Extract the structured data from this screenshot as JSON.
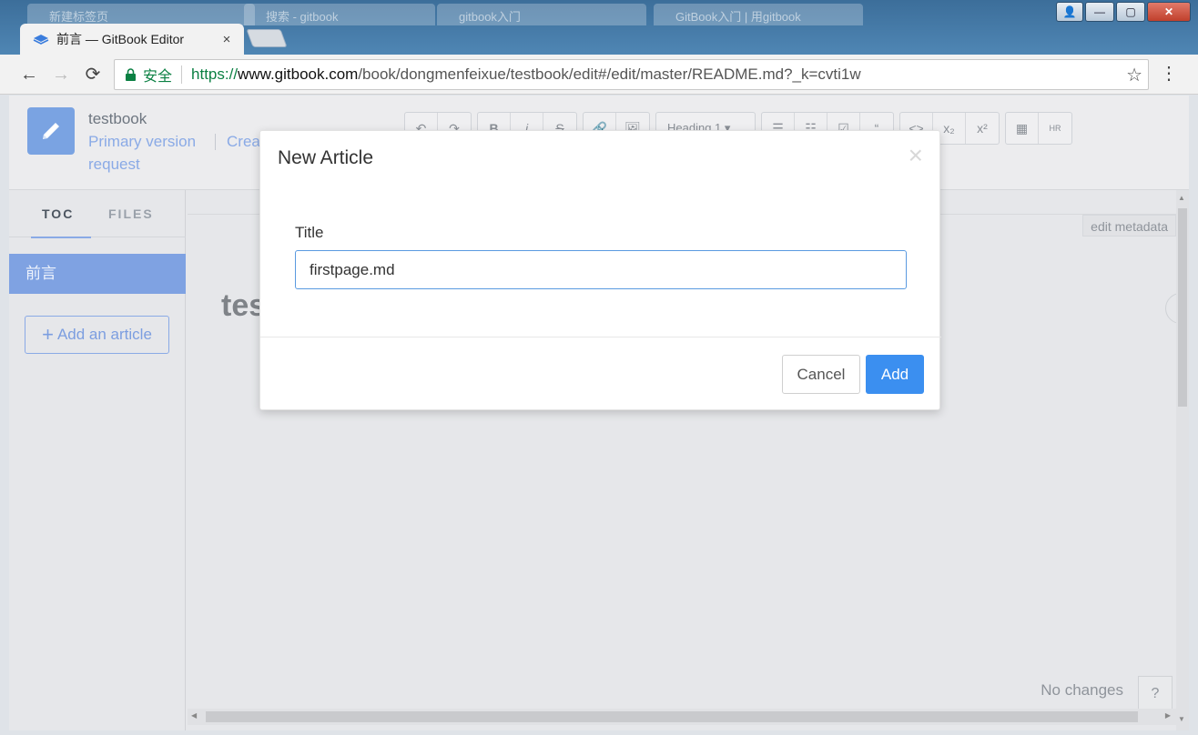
{
  "browser": {
    "background_tabs": [
      {
        "title": "新建标签页"
      },
      {
        "title": "搜索 - gitbook"
      },
      {
        "title": "gitbook入门"
      },
      {
        "title": "GitBook入门 | 用gitbook"
      }
    ],
    "active_tab": {
      "title": "前言 — GitBook Editor",
      "close": "×"
    },
    "window_controls": {
      "minimize": "—",
      "maximize": "▢",
      "close": "✕",
      "user": "👤"
    },
    "nav": {
      "back": "←",
      "forward": "→",
      "reload": "⟳"
    },
    "address": {
      "secure_label": "安全",
      "url_scheme": "https://",
      "url_host": "www.gitbook.com",
      "url_path": "/book/dongmenfeixue/testbook/edit#/edit/master/README.md?_k=cvti1w"
    },
    "star": "☆",
    "menu": "⋮"
  },
  "editor": {
    "book_title": "testbook",
    "primary_version": "Primary version",
    "create_link": "Crea",
    "request_link": "request",
    "toolbar": {
      "undo": "↶",
      "redo": "↷",
      "bold": "B",
      "italic": "i",
      "strike": "S",
      "link": "🔗",
      "image": "🖼",
      "heading": "Heading 1 ▾",
      "ul": "☰",
      "ol": "☷",
      "task": "☑",
      "quote": "“",
      "code": "<>",
      "sub": "x₂",
      "sup": "x²",
      "table": "▦",
      "hr": "HR"
    }
  },
  "sidebar": {
    "tabs": [
      {
        "label": "TOC"
      },
      {
        "label": "FILES"
      }
    ],
    "items": [
      {
        "label": "前言"
      }
    ],
    "add_article": "Add an article",
    "add_icon": "+"
  },
  "content": {
    "edit_metadata": "edit metadata",
    "heading_partial": "tes",
    "no_changes": "No changes",
    "help": "?",
    "round_btn": "★"
  },
  "modal": {
    "title": "New Article",
    "close": "×",
    "field_label": "Title",
    "input_value": "firstpage.md",
    "cancel": "Cancel",
    "add": "Add"
  }
}
